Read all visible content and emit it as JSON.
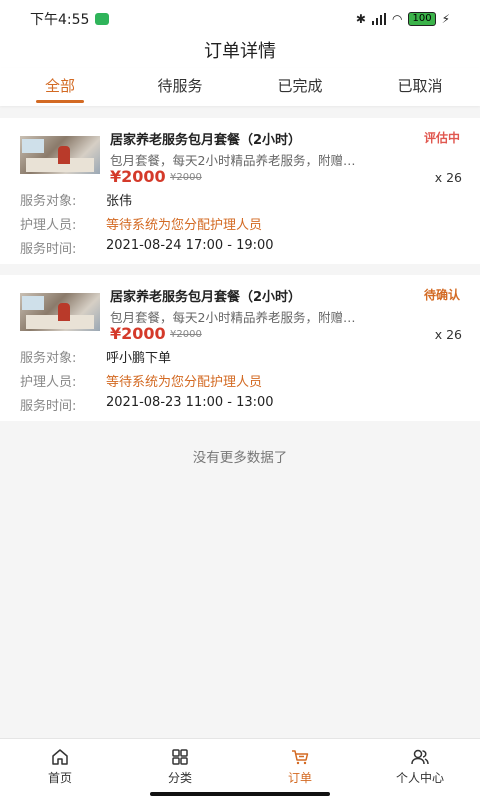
{
  "status_bar": {
    "time": "下午4:55",
    "battery": "100"
  },
  "header": {
    "title": "订单详情"
  },
  "tabs": [
    {
      "label": "全部",
      "active": true
    },
    {
      "label": "待服务",
      "active": false
    },
    {
      "label": "已完成",
      "active": false
    },
    {
      "label": "已取消",
      "active": false
    }
  ],
  "orders": [
    {
      "title": "居家养老服务包月套餐（2小时）",
      "status": "评估中",
      "status_color": "#e0574f",
      "desc": "包月套餐，每天2小时精品养老服务，附赠…",
      "price": "¥2000",
      "old_price": "¥2000",
      "qty": "x 26",
      "service_target_label": "服务对象:",
      "service_target": "张伟",
      "caregiver_label": "护理人员:",
      "caregiver": "等待系统为您分配护理人员",
      "service_time_label": "服务时间:",
      "service_time": "2021-08-24 17:00 - 19:00"
    },
    {
      "title": "居家养老服务包月套餐（2小时）",
      "status": "待确认",
      "status_color": "#d36a23",
      "desc": "包月套餐，每天2小时精品养老服务，附赠…",
      "price": "¥2000",
      "old_price": "¥2000",
      "qty": "x 26",
      "service_target_label": "服务对象:",
      "service_target": "呼小鹏下单",
      "caregiver_label": "护理人员:",
      "caregiver": "等待系统为您分配护理人员",
      "service_time_label": "服务时间:",
      "service_time": "2021-08-23 11:00 - 13:00"
    }
  ],
  "footer_text": "没有更多数据了",
  "bottom_nav": [
    {
      "label": "首页",
      "icon": "home-icon",
      "active": false
    },
    {
      "label": "分类",
      "icon": "grid-icon",
      "active": false
    },
    {
      "label": "订单",
      "icon": "cart-icon",
      "active": true
    },
    {
      "label": "个人中心",
      "icon": "user-icon",
      "active": false
    }
  ],
  "colors": {
    "accent": "#d36a23",
    "price": "#d43a2a"
  }
}
